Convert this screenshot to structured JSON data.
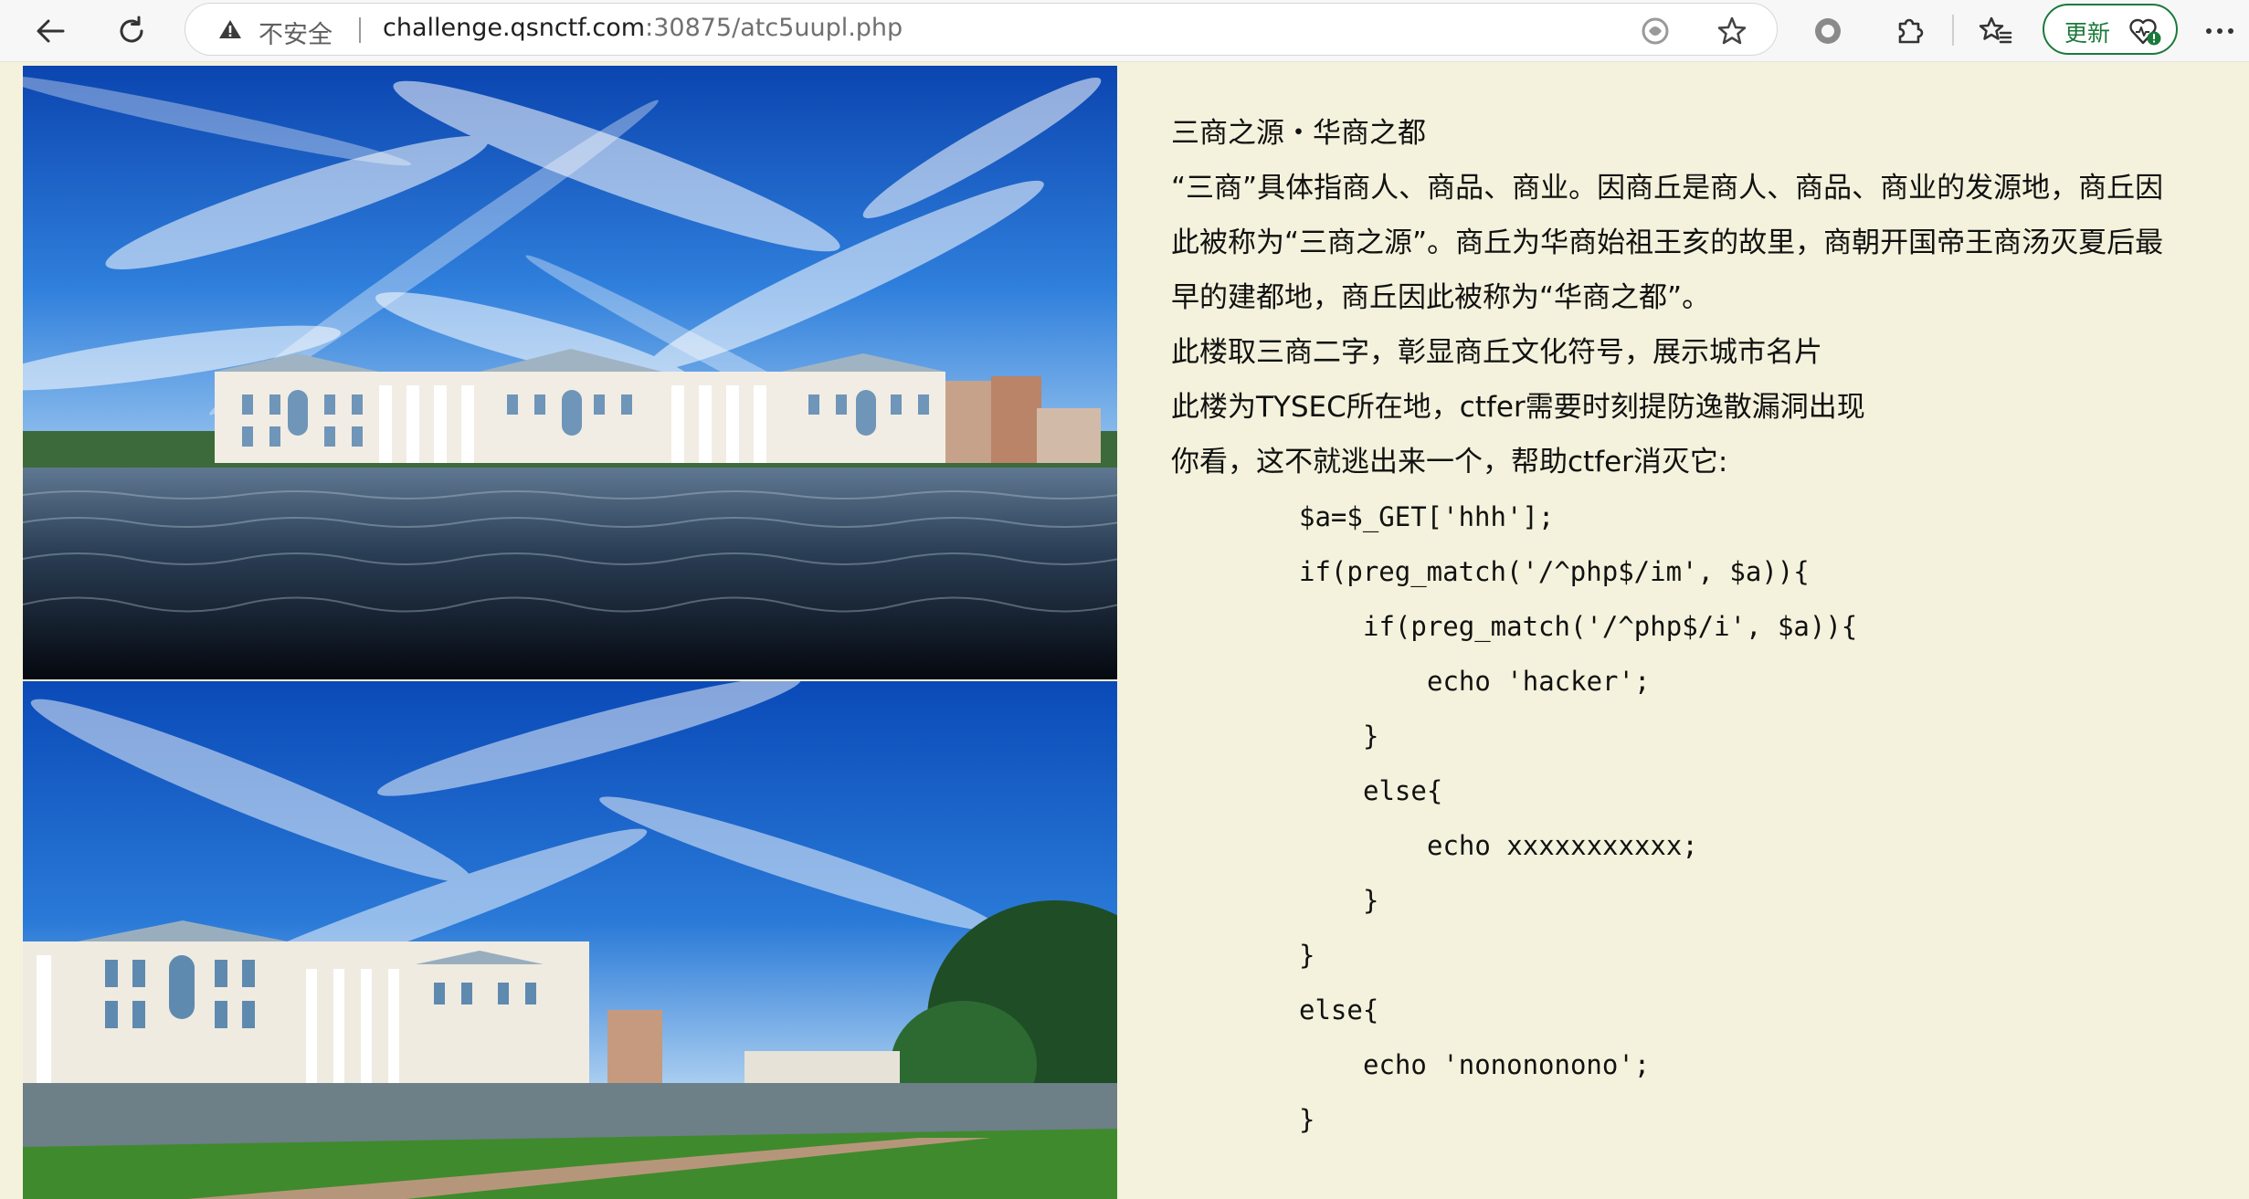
{
  "browser": {
    "security_label": "不安全",
    "url_host": "challenge.qsnctf.com",
    "url_rest": ":30875/atc5uupl.php",
    "update_label": "更新",
    "more_label": "···"
  },
  "article": {
    "title": "三商之源・华商之都",
    "para1_line1": "“三商”具体指商人、商品、商业。因商丘是商人、商品、商业的发源地，商丘因",
    "para1_line2": "此被称为“三商之源”。商丘为华商始祖王亥的故里，商朝开国帝王商汤灭夏后最",
    "para1_line3": "早的建都地，商丘因此被称为“华商之都”。",
    "para2": "此楼取三商二字，彰显商丘文化符号，展示城市名片",
    "para3": "此楼为TYSEC所在地，ctfer需要时刻提防逸散漏洞出现",
    "para4": "你看，这不就逃出来一个，帮助ctfer消灭它:"
  },
  "code": [
    "$a=$_GET['hhh'];",
    "if(preg_match('/^php$/im', $a)){",
    "if(preg_match('/^php$/i', $a)){",
    "echo 'hacker';",
    "}",
    "else{",
    "echo xxxxxxxxxxx;",
    "}",
    "}",
    "else{",
    "echo 'nonononono';",
    "}"
  ],
  "colors": {
    "page_background": "#f4f2dc",
    "update_green": "#1b7a3b",
    "sky_blue": "#1f63c8"
  },
  "icons": {
    "back": "back-arrow-icon",
    "refresh": "refresh-icon",
    "warning": "warning-triangle-icon",
    "read_aloud": "read-aloud-icon",
    "favorite": "star-icon",
    "browser_essentials": "circle-icon",
    "extensions": "puzzle-icon",
    "favorites": "favorites-icon",
    "more": "more-icon"
  }
}
